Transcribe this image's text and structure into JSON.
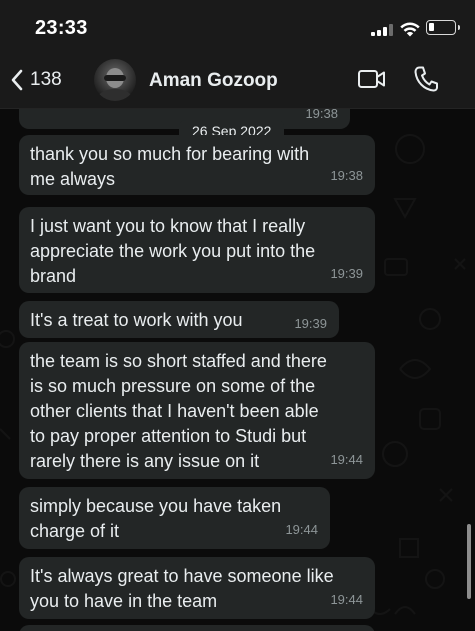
{
  "status_bar": {
    "time": "23:33"
  },
  "header": {
    "back_count": "138",
    "contact_name": "Aman Gozoop"
  },
  "chat": {
    "date_divider": "26 Sep 2022",
    "messages": [
      {
        "lines": [],
        "time": "19:38"
      },
      {
        "lines": [
          "thank you so much for bearing with",
          "me always"
        ],
        "time": "19:38"
      },
      {
        "lines": [
          "I just want you to know that I really",
          "appreciate the work you put into the",
          "brand"
        ],
        "time": "19:39"
      },
      {
        "lines": [
          "It's a treat to work with you"
        ],
        "time": "19:39"
      },
      {
        "lines": [
          "the team is so short staffed and there",
          "is so much pressure on some of the",
          "other clients that I haven't been able",
          "to pay proper attention to Studi but",
          "rarely there is any issue on it"
        ],
        "time": "19:44"
      },
      {
        "lines": [
          "simply because you have taken",
          "charge of it"
        ],
        "time": "19:44"
      },
      {
        "lines": [
          "It's always great to have someone like",
          "you to have in the team"
        ],
        "time": "19:44"
      }
    ]
  }
}
